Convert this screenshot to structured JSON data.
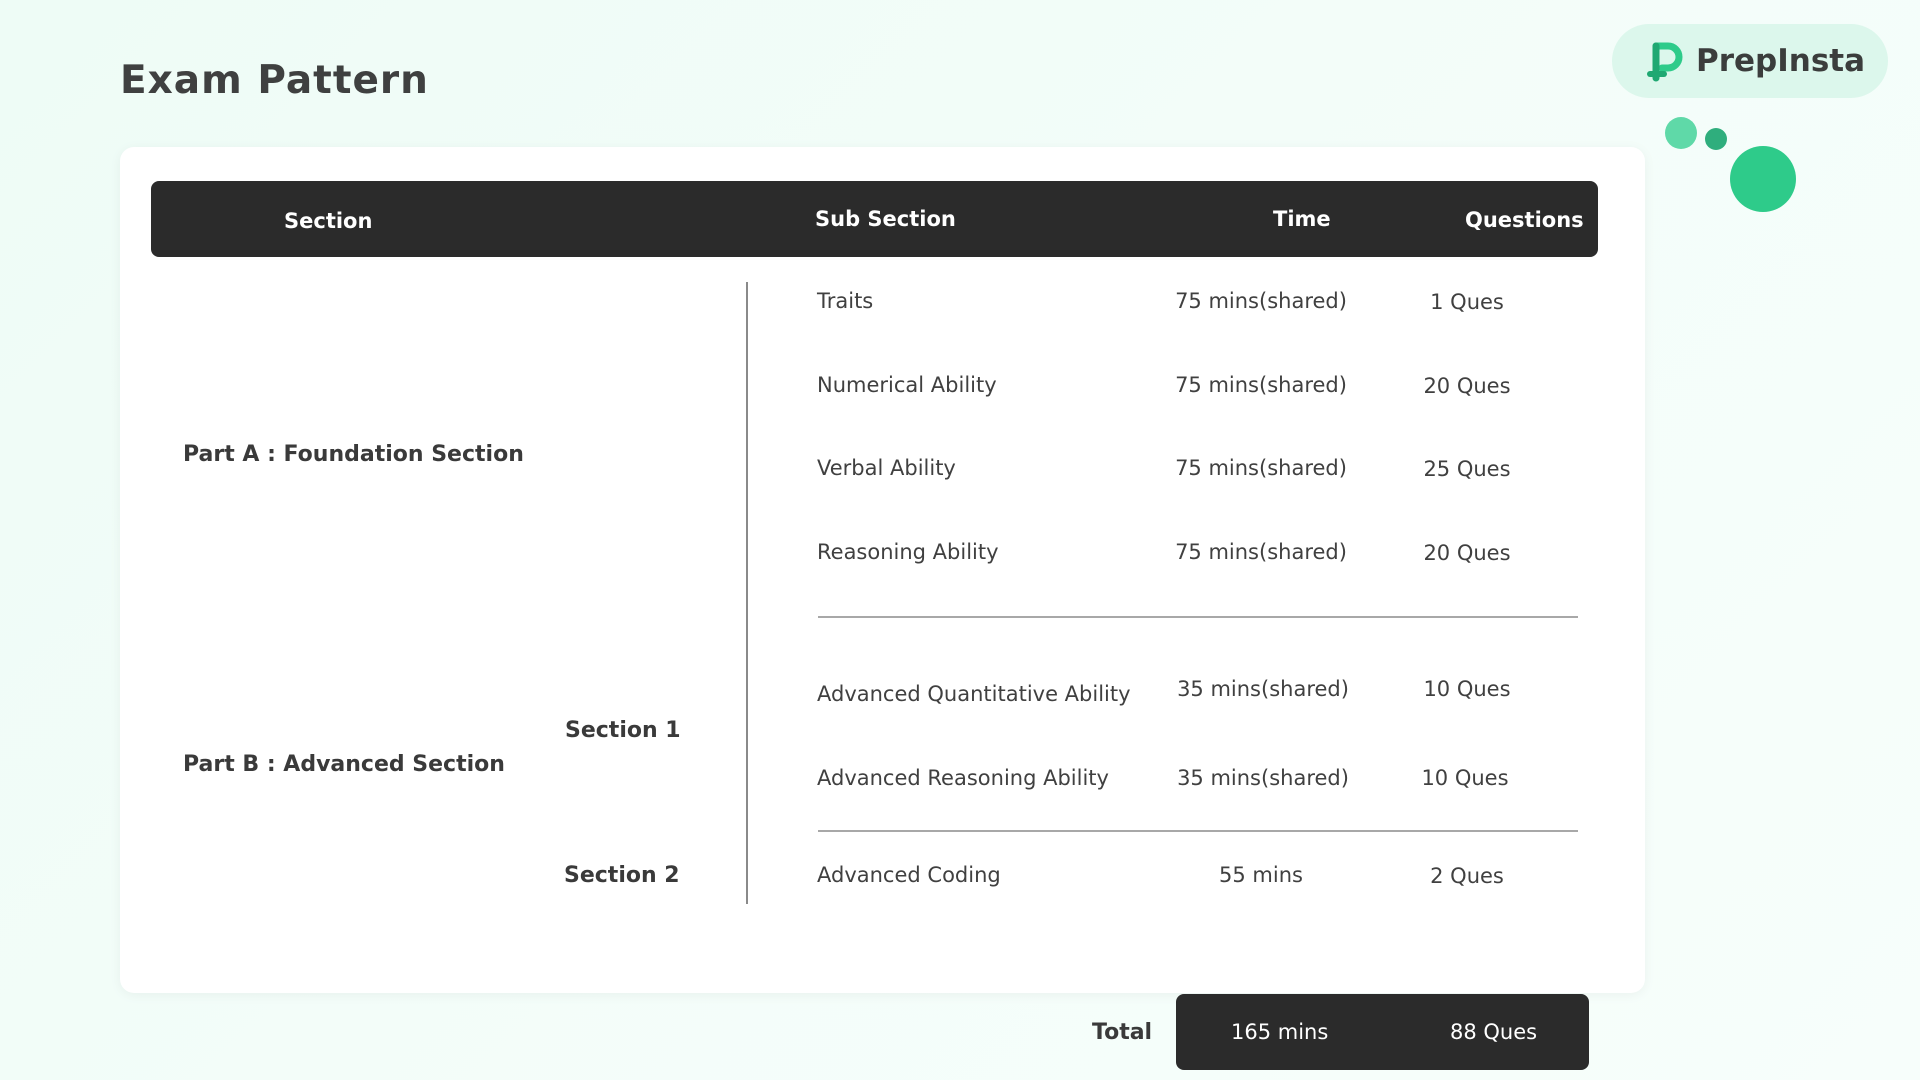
{
  "page": {
    "title": "Exam Pattern"
  },
  "brand": {
    "name": "PrepInsta",
    "accent_color": "#2ecb8a",
    "pill_color": "#dcf7ec",
    "logo_icon": "prepinsta-p-logo-icon"
  },
  "table": {
    "header": {
      "section": "Section",
      "sub_section": "Sub Section",
      "time": "Time",
      "questions": "Questions"
    },
    "part_a": {
      "label": "Part A : Foundation Section",
      "rows": [
        {
          "name": "Traits",
          "time": "75 mins(shared)",
          "questions": "1 Ques"
        },
        {
          "name": "Numerical Ability",
          "time": "75 mins(shared)",
          "questions": "20 Ques"
        },
        {
          "name": "Verbal Ability",
          "time": "75 mins(shared)",
          "questions": "25 Ques"
        },
        {
          "name": "Reasoning Ability",
          "time": "75 mins(shared)",
          "questions": "20 Ques"
        }
      ]
    },
    "part_b": {
      "label": "Part B : Advanced Section",
      "section_1": {
        "label": "Section 1",
        "rows": [
          {
            "name": "Advanced Quantitative Ability",
            "time": "35 mins(shared)",
            "questions": "10 Ques"
          },
          {
            "name": "Advanced Reasoning Ability",
            "time": "35 mins(shared)",
            "questions": "10 Ques"
          }
        ]
      },
      "section_2": {
        "label": "Section 2",
        "rows": [
          {
            "name": "Advanced Coding",
            "time": "55 mins",
            "questions": "2 Ques"
          }
        ]
      }
    },
    "total": {
      "label": "Total",
      "time": "165 mins",
      "questions": "88 Ques"
    }
  }
}
